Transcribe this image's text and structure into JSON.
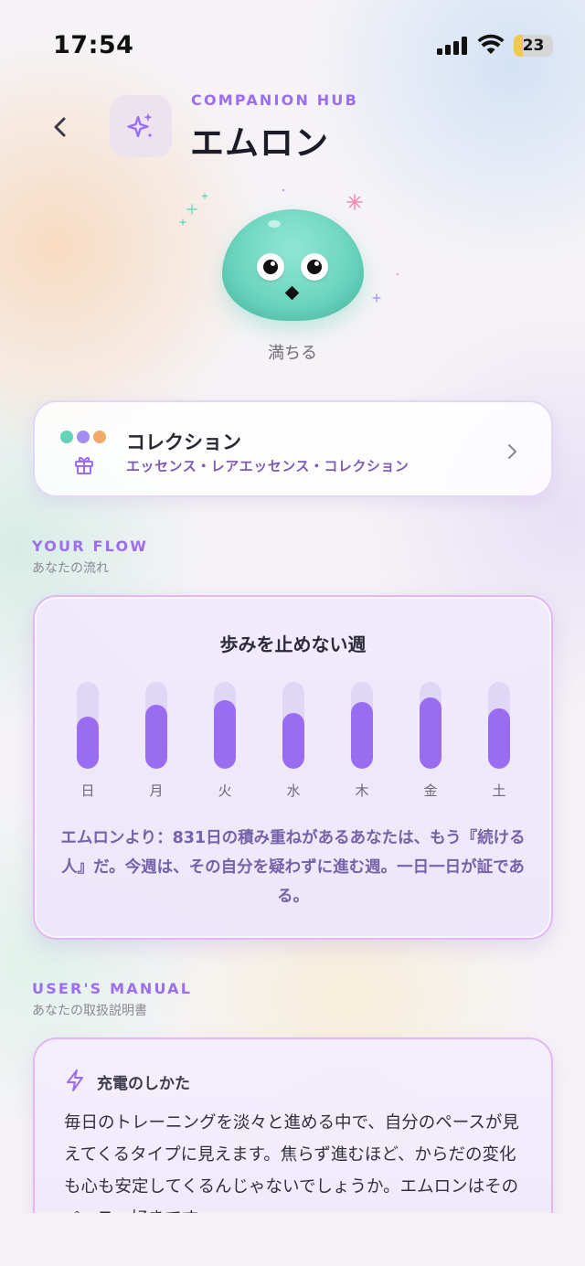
{
  "status_bar": {
    "time": "17:54",
    "battery": "23",
    "battery_level": 0.23
  },
  "header": {
    "eyebrow": "COMPANION HUB",
    "title": "エムロン",
    "icon": "sparkles-icon"
  },
  "mascot": {
    "mood": "満ちる"
  },
  "collection": {
    "title": "コレクション",
    "subtitle": "エッセンス・レアエッセンス・コレクション",
    "dot_colors": [
      "#62d3b8",
      "#a48cf4",
      "#f0ab6b"
    ]
  },
  "flow": {
    "label": "YOUR FLOW",
    "sub": "あなたの流れ",
    "title": "歩みを止めない週",
    "days": [
      {
        "label": "日",
        "level": 0.6
      },
      {
        "label": "月",
        "level": 0.74
      },
      {
        "label": "火",
        "level": 0.79
      },
      {
        "label": "水",
        "level": 0.64
      },
      {
        "label": "木",
        "level": 0.77
      },
      {
        "label": "金",
        "level": 0.82
      },
      {
        "label": "土",
        "level": 0.69
      }
    ],
    "message": "エムロンより：831日の積み重ねがあるあなたは、もう『続ける人』だ。今週は、その自分を疑わずに進む週。一日一日が証である。"
  },
  "manual": {
    "label": "USER'S MANUAL",
    "sub": "あなたの取扱説明書",
    "card_title": "充電のしかた",
    "card_text": "毎日のトレーニングを淡々と進める中で、自分のペースが見えてくるタイプに見えます。焦らず進むほど、からだの変化も心も安定してくるんじゃないでしょうか。エムロンはそのペース、好きです。"
  },
  "colors": {
    "accent": "#9b6ef0",
    "bar": "#9a6cf2",
    "mascot": "#6fd8c1"
  }
}
